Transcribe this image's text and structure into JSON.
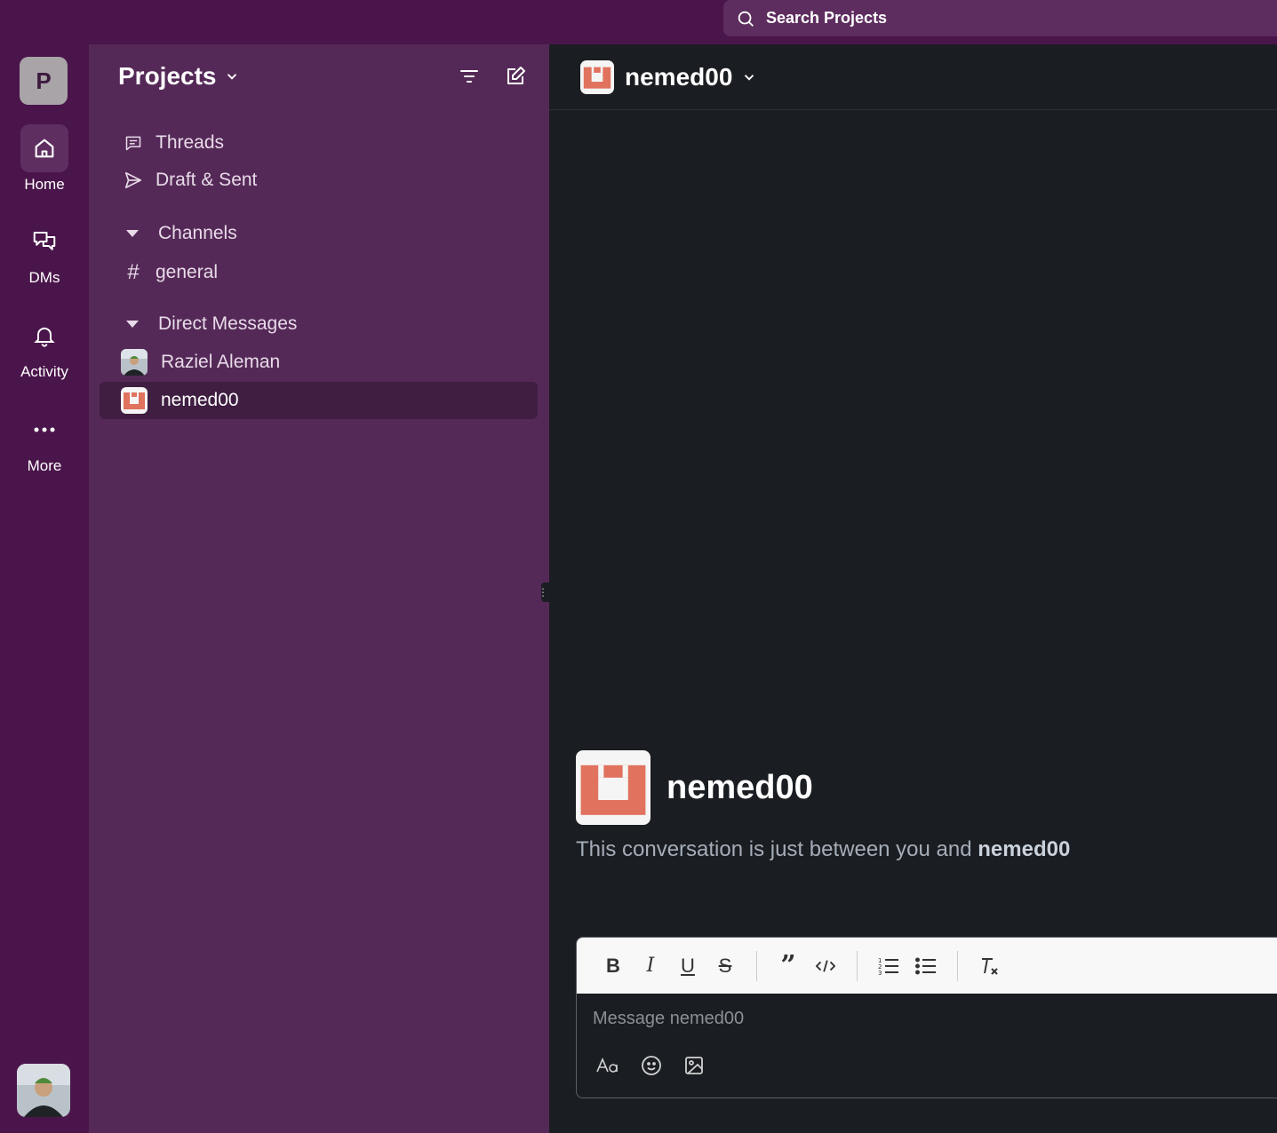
{
  "topbar": {
    "search_placeholder": "Search Projects"
  },
  "rail": {
    "workspace_initial": "P",
    "items": [
      {
        "label": "Home",
        "icon": "home-icon",
        "active": true
      },
      {
        "label": "DMs",
        "icon": "chat-bubbles-icon",
        "active": false
      },
      {
        "label": "Activity",
        "icon": "bell-icon",
        "active": false
      },
      {
        "label": "More",
        "icon": "ellipsis-icon",
        "active": false
      }
    ]
  },
  "sidebar": {
    "title": "Projects",
    "nav": [
      {
        "label": "Threads",
        "icon": "threads-icon"
      },
      {
        "label": "Draft & Sent",
        "icon": "send-icon"
      }
    ],
    "channels_header": "Channels",
    "channels": [
      {
        "label": "general"
      }
    ],
    "dm_header": "Direct Messages",
    "dms": [
      {
        "label": "Raziel Aleman",
        "active": false
      },
      {
        "label": "nemed00",
        "active": true
      }
    ]
  },
  "main": {
    "title": "nemed00",
    "intro": {
      "name": "nemed00",
      "text_prefix": "This conversation is just between you and ",
      "text_bold": "nemed00"
    },
    "composer": {
      "placeholder": "Message nemed00",
      "toolbar": [
        "bold",
        "italic",
        "underline",
        "strikethrough",
        "quote",
        "code",
        "ordered-list",
        "bullet-list",
        "clear-format"
      ]
    }
  },
  "colors": {
    "rail_bg": "#4a154b",
    "sidebar_bg": "#552957",
    "active_item": "#3f1e42",
    "main_bg": "#1a1d21",
    "brand_avatar": "#e0725e"
  }
}
